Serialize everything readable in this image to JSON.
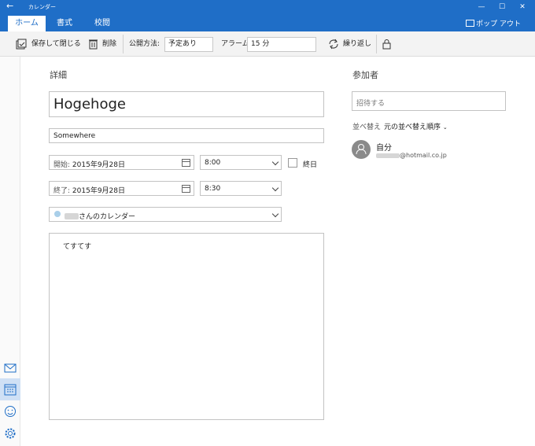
{
  "window": {
    "title": "カレンダー",
    "back_glyph": "←",
    "minimize_glyph": "—",
    "maximize_glyph": "☐",
    "close_glyph": "✕"
  },
  "ribbon": {
    "tabs": [
      {
        "label": "ホーム",
        "active": true
      },
      {
        "label": "書式",
        "active": false
      },
      {
        "label": "校閲",
        "active": false
      }
    ],
    "popout_label": "ポップ アウト"
  },
  "toolbar": {
    "save_close_label": "保存して閉じる",
    "delete_label": "削除",
    "show_as_label": "公開方法:",
    "show_as_value": "予定あり",
    "alarm_label": "アラーム:",
    "alarm_value": "15 分",
    "repeat_label": "繰り返し"
  },
  "details": {
    "section_title": "詳細",
    "event_title": "Hogehoge",
    "location": "Somewhere",
    "start_label": "開始:",
    "start_date": "2015年9月28日",
    "start_time": "8:00",
    "all_day_label": "終日",
    "end_label": "終了:",
    "end_date": "2015年9月28日",
    "end_time": "8:30",
    "calendar_suffix": "さんのカレンダー",
    "notes": "てすてす"
  },
  "attendees": {
    "section_title": "参加者",
    "invite_placeholder": "招待する",
    "sort_label": "並べ替え",
    "sort_value": "元の並べ替え順序",
    "self_name": "自分",
    "self_email_domain": "@hotmail.co.jp"
  },
  "colors": {
    "accent": "#1f6ec7",
    "calendar_dot": "#a9cfe9"
  }
}
